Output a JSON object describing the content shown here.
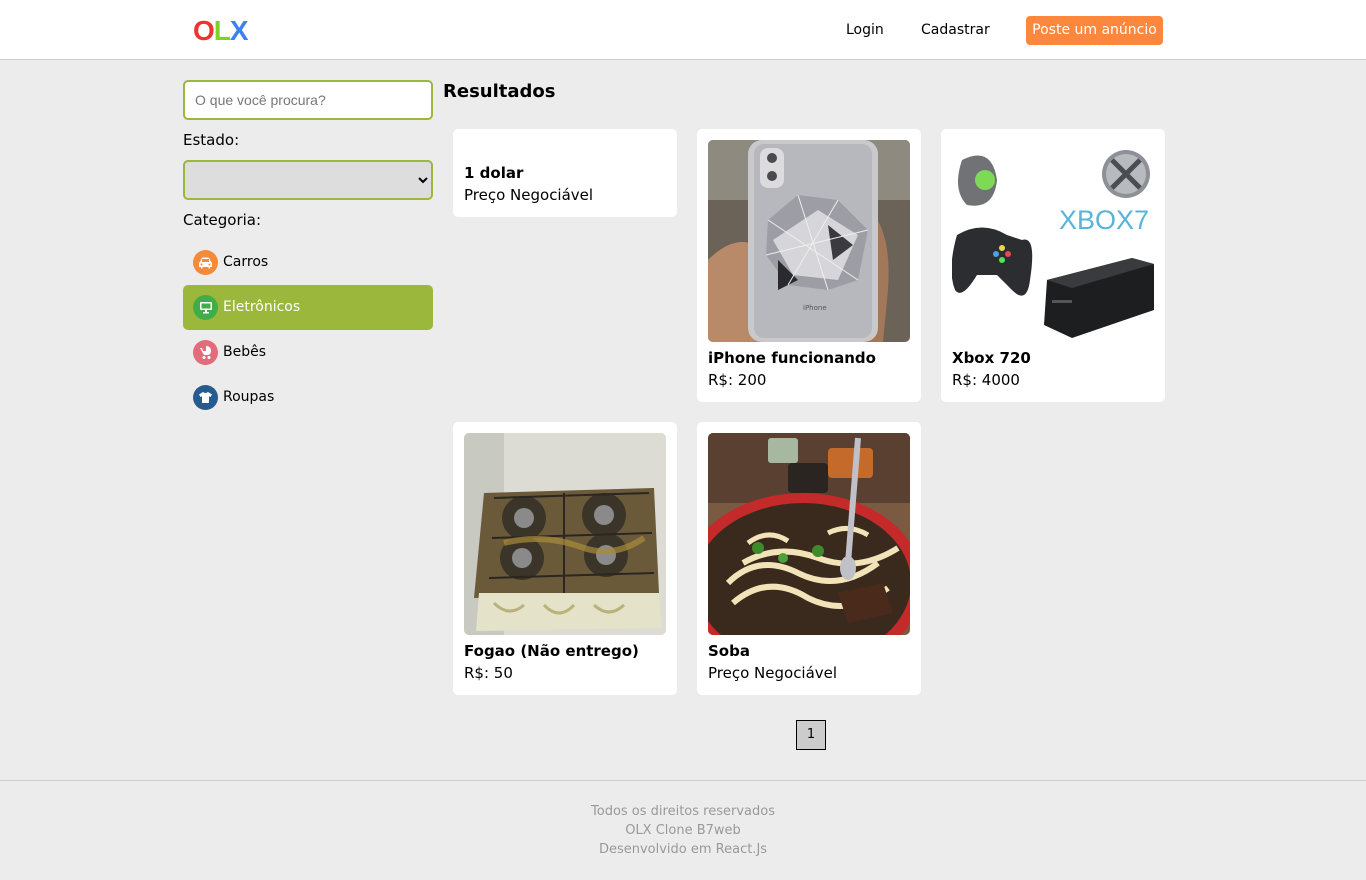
{
  "header": {
    "logo": {
      "o": "O",
      "l": "L",
      "x": "X"
    },
    "nav": {
      "login": "Login",
      "register": "Cadastrar",
      "post_ad": "Poste um anúncio"
    }
  },
  "sidebar": {
    "search": {
      "placeholder": "O que você procura?",
      "value": ""
    },
    "state": {
      "label": "Estado:",
      "selected": ""
    },
    "category": {
      "label": "Categoria:",
      "items": [
        {
          "label": "Carros",
          "icon": "car-icon",
          "color": "#f58a3a",
          "active": false
        },
        {
          "label": "Eletrônicos",
          "icon": "monitor-icon",
          "color": "#3fae49",
          "active": true
        },
        {
          "label": "Bebês",
          "icon": "baby-stroller-icon",
          "color": "#e26c7a",
          "active": false
        },
        {
          "label": "Roupas",
          "icon": "tshirt-icon",
          "color": "#255b8f",
          "active": false
        }
      ]
    }
  },
  "results": {
    "title": "Resultados",
    "items": [
      {
        "title": "1 dolar",
        "price": "Preço Negociável",
        "image": "none"
      },
      {
        "title": "iPhone funcionando",
        "price": "R$: 200",
        "image": "cracked-iphone-photo"
      },
      {
        "title": "Xbox 720",
        "price": "R$: 4000",
        "image": "xbox-console-photo",
        "image_text": "XBOX7"
      },
      {
        "title": "Fogao (Não entrego)",
        "price": "R$: 50",
        "image": "dirty-stove-photo"
      },
      {
        "title": "Soba",
        "price": "Preço Negociável",
        "image": "soba-bowl-photo"
      }
    ]
  },
  "pagination": {
    "pages": [
      "1"
    ],
    "current": "1"
  },
  "footer": {
    "line1": "Todos os direitos reservados",
    "line2": "OLX Clone B7web",
    "line3": "Desenvolvido em React.Js"
  },
  "colors": {
    "accent": "#9bb83c",
    "post_button": "#fd873c",
    "background": "#ececec"
  }
}
